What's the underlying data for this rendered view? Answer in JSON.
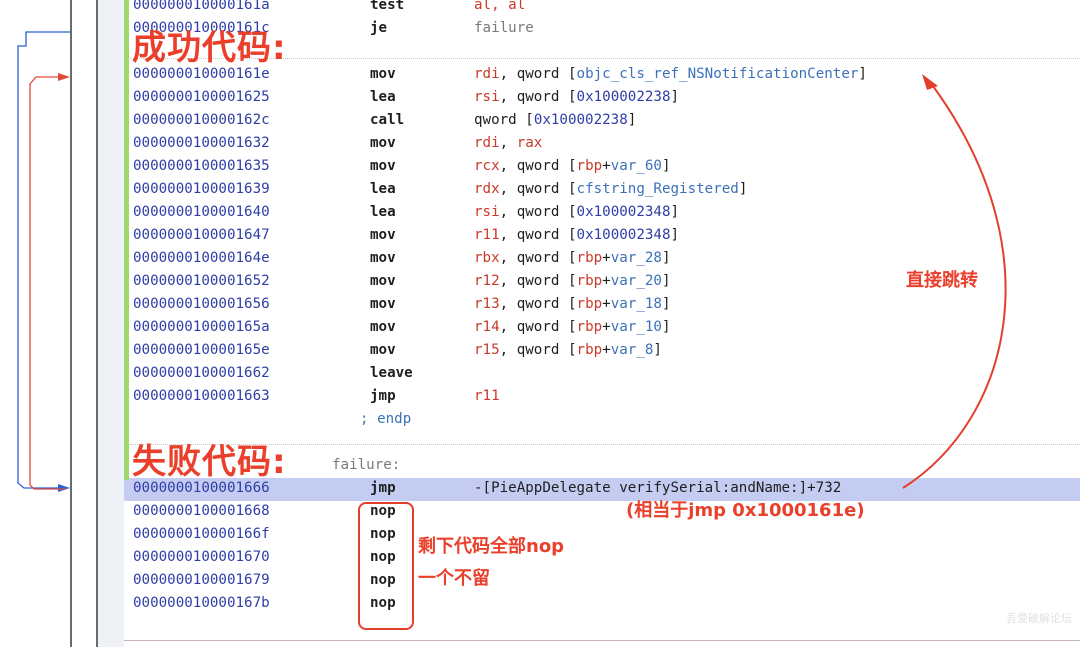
{
  "listing": {
    "rows": [
      {
        "addr": "000000010000161a",
        "mnemonic": "test",
        "op": "al, al"
      },
      {
        "addr": "000000010000161c",
        "mnemonic": "je",
        "op": "failure"
      },
      {
        "addr": "000000010000161e",
        "mnemonic": "mov",
        "op": "rdi, qword [objc_cls_ref_NSNotificationCenter]"
      },
      {
        "addr": "0000000100001625",
        "mnemonic": "lea",
        "op": "rsi, qword [0x100002238]"
      },
      {
        "addr": "000000010000162c",
        "mnemonic": "call",
        "op": "qword [0x100002238]"
      },
      {
        "addr": "0000000100001632",
        "mnemonic": "mov",
        "op": "rdi, rax"
      },
      {
        "addr": "0000000100001635",
        "mnemonic": "mov",
        "op": "rcx, qword [rbp+var_60]"
      },
      {
        "addr": "0000000100001639",
        "mnemonic": "lea",
        "op": "rdx, qword [cfstring_Registered]"
      },
      {
        "addr": "0000000100001640",
        "mnemonic": "lea",
        "op": "rsi, qword [0x100002348]"
      },
      {
        "addr": "0000000100001647",
        "mnemonic": "mov",
        "op": "r11, qword [0x100002348]"
      },
      {
        "addr": "000000010000164e",
        "mnemonic": "mov",
        "op": "rbx, qword [rbp+var_28]"
      },
      {
        "addr": "0000000100001652",
        "mnemonic": "mov",
        "op": "r12, qword [rbp+var_20]"
      },
      {
        "addr": "0000000100001656",
        "mnemonic": "mov",
        "op": "r13, qword [rbp+var_18]"
      },
      {
        "addr": "000000010000165a",
        "mnemonic": "mov",
        "op": "r14, qword [rbp+var_10]"
      },
      {
        "addr": "000000010000165e",
        "mnemonic": "mov",
        "op": "r15, qword [rbp+var_8]"
      },
      {
        "addr": "0000000100001662",
        "mnemonic": "leave",
        "op": ""
      },
      {
        "addr": "0000000100001663",
        "mnemonic": "jmp",
        "op": "r11"
      },
      {
        "addr": "0000000100001666",
        "mnemonic": "jmp",
        "op": "-[PieAppDelegate verifySerial:andName:]+732"
      },
      {
        "addr": "0000000100001668",
        "mnemonic": "nop",
        "op": ""
      },
      {
        "addr": "000000010000166f",
        "mnemonic": "nop",
        "op": ""
      },
      {
        "addr": "0000000100001670",
        "mnemonic": "nop",
        "op": ""
      },
      {
        "addr": "0000000100001679",
        "mnemonic": "nop",
        "op": ""
      },
      {
        "addr": "000000010000167b",
        "mnemonic": "nop",
        "op": ""
      }
    ],
    "endp": "; endp",
    "failure_label": "failure:"
  },
  "annotations": {
    "success": "成功代码:",
    "failure": "失败代码:",
    "direct_jump": "直接跳转",
    "equivalent": "(相当于jmp 0x1000161e)",
    "nop_rest": "剩下代码全部nop",
    "keep_none": "一个不留"
  },
  "watermark": "吾爱破解论坛",
  "colors": {
    "address": "#2e3ea6",
    "register": "#c93a2a",
    "symbol": "#3b72b8",
    "annotation": "#ea3f2b",
    "highlight": "#c5ccf1",
    "jump_arrow": "#2f5fd6"
  }
}
